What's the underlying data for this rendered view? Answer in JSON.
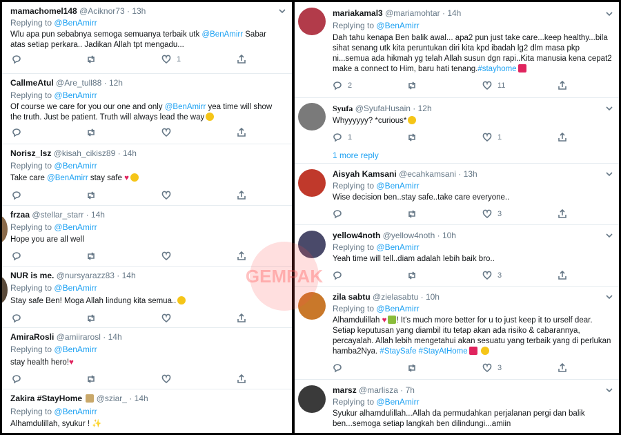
{
  "colors": {
    "link": "#1da1f2",
    "muted": "#657786",
    "heart": "#e0245e"
  },
  "watermark": "GEMPAK",
  "left_tweets": [
    {
      "name": "mamachomel148",
      "handle": "@Aciknor73",
      "time": "13h",
      "reply_label": "Replying to",
      "reply_to": "@BenAmirr",
      "body_pre": "Wlu apa pun sebabnya semoga semuanya terbaik  utk ",
      "body_mention": "@BenAmirr",
      "body_post": " Sabar atas setiap perkara.. Jadikan Allah tpt mengadu...",
      "like_count": "1"
    },
    {
      "name": "CallmeAtul",
      "handle": "@Are_tull88",
      "time": "12h",
      "reply_label": "Replying to",
      "reply_to": "@BenAmirr",
      "body_pre": "Of course we care for you our one and only ",
      "body_mention": "@BenAmirr",
      "body_post": " yea time will show the truth. Just be patient. Truth will always lead the way",
      "like_count": ""
    },
    {
      "name": "Norisz_lsz",
      "handle": "@kisah_cikisz89",
      "time": "14h",
      "reply_label": "Replying to",
      "reply_to": "@BenAmirr",
      "body_pre": "Take care ",
      "body_mention": "@BenAmirr",
      "body_post": " stay safe",
      "like_count": ""
    },
    {
      "name": "frzaa",
      "handle": "@stellar_starr",
      "time": "14h",
      "reply_label": "Replying to",
      "reply_to": "@BenAmirr",
      "body_pre": "Hope you are all well",
      "body_mention": "",
      "body_post": "",
      "like_count": ""
    },
    {
      "name": "NUR is me.",
      "handle": "@nursyarazz83",
      "time": "14h",
      "reply_label": "Replying to",
      "reply_to": "@BenAmirr",
      "body_pre": "Stay safe Ben! Moga Allah lindung kita semua..",
      "body_mention": "",
      "body_post": "",
      "like_count": ""
    },
    {
      "name": "AmiraRosli",
      "handle": "@amiirarosl",
      "time": "14h",
      "reply_label": "Replying to",
      "reply_to": "@BenAmirr",
      "body_pre": "stay health hero!",
      "body_mention": "",
      "body_post": "",
      "like_count": ""
    },
    {
      "name": "Zakira #StayHome",
      "handle": "@sziar_",
      "time": "14h",
      "reply_label": "Replying to",
      "reply_to": "@BenAmirr",
      "body_pre": "Alhamdulillah, syukur !",
      "body_mention": "",
      "body_post": "",
      "like_count": ""
    }
  ],
  "right_tweets": [
    {
      "name": "mariakamal3",
      "handle": "@mariamohtar",
      "time": "14h",
      "reply_label": "Replying to",
      "reply_to": "@BenAmirr",
      "body_pre": "Dah tahu kenapa Ben balik awal... apa2 pun just take care...keep healthy...bila sihat senang utk kita peruntukan diri kita kpd ibadah lg2 dlm masa pkp ni...semua ada hikmah yg telah Allah susun dgn rapi..Kita manusia kena cepat2 make a connect to Him, baru hati tenang.",
      "body_tag": "#stayhome",
      "body_post": "",
      "reply_count": "2",
      "like_count": "11"
    },
    {
      "name": "Syufa",
      "handle": "@SyufaHusain",
      "time": "12h",
      "reply_label": "",
      "reply_to": "",
      "body_pre": "Whyyyyyy? *curious*",
      "body_tag": "",
      "body_post": "",
      "reply_count": "1",
      "like_count": "1",
      "more_replies": "1 more reply"
    },
    {
      "name": "Aisyah Kamsani",
      "handle": "@ecahkamsani",
      "time": "13h",
      "reply_label": "Replying to",
      "reply_to": "@BenAmirr",
      "body_pre": "Wise decision ben..stay safe..take care everyone..",
      "body_tag": "",
      "body_post": "",
      "reply_count": "",
      "like_count": "3"
    },
    {
      "name": "yellow4noth",
      "handle": "@yellow4noth",
      "time": "10h",
      "reply_label": "Replying to",
      "reply_to": "@BenAmirr",
      "body_pre": "Yeah time will tell..diam adalah lebih baik bro..",
      "body_tag": "",
      "body_post": "",
      "reply_count": "",
      "like_count": "3"
    },
    {
      "name": "zila sabtu",
      "handle": "@zielasabtu",
      "time": "10h",
      "reply_label": "Replying to",
      "reply_to": "@BenAmirr",
      "body_pre": "Alhamdulillah",
      "body_mid": "! It's much more better for u to just keep it to urself dear. Setiap keputusan yang diambil itu tetap akan ada risiko & cabarannya, percayalah. Allah lebih mengetahui akan sesuatu yang terbaik yang di perlukan hamba2Nya.",
      "body_tag": "#StaySafe #StayAtHome",
      "body_post": "",
      "reply_count": "",
      "like_count": "3"
    },
    {
      "name": "marsz",
      "handle": "@marlisza",
      "time": "7h",
      "reply_label": "Replying to",
      "reply_to": "@BenAmirr",
      "body_pre": "Syukur alhamdulillah...Allah da permudahkan perjalanan pergi dan balik ben...semoga setiap langkah ben dilindungi...amiin",
      "body_tag": "",
      "body_post": "",
      "reply_count": "",
      "like_count": ""
    }
  ]
}
